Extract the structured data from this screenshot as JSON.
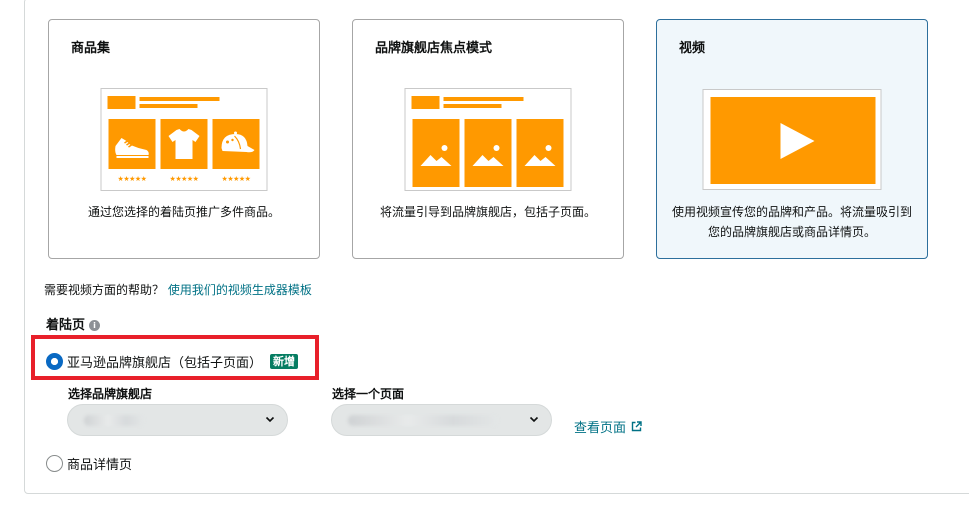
{
  "cards": [
    {
      "title": "商品集",
      "description": "通过您选择的着陆页推广多件商品。",
      "selected": false,
      "stars": [
        "★★★★★",
        "★★★★★",
        "★★★★★"
      ]
    },
    {
      "title": "品牌旗舰店焦点模式",
      "description": "将流量引导到品牌旗舰店，包括子页面。",
      "selected": false
    },
    {
      "title": "视频",
      "description": "使用视频宣传您的品牌和产品。将流量吸引到您的品牌旗舰店或商品详情页。",
      "selected": true
    }
  ],
  "help": {
    "question": "需要视频方面的帮助？",
    "link_text": "使用我们的视频生成器模板"
  },
  "landing_page": {
    "label": "着陆页",
    "info_icon": "i",
    "options": [
      {
        "label": "亚马逊品牌旗舰店（包括子页面）",
        "badge": "新增",
        "selected": true
      },
      {
        "label": "商品详情页",
        "selected": false
      }
    ]
  },
  "store_select": {
    "label": "选择品牌旗舰店"
  },
  "page_select": {
    "label": "选择一个页面"
  },
  "view_page": {
    "label": "查看页面"
  },
  "colors": {
    "accent": "#FF9900",
    "selected_bg": "#F0F7FB",
    "link": "#007185",
    "radio": "#0969C3",
    "badge": "#067D62",
    "highlight": "#E8202A"
  },
  "icons": {
    "shoe": "shoe-icon",
    "shirt": "tshirt-icon",
    "cap": "cap-icon",
    "image": "image-placeholder-icon",
    "play": "play-icon",
    "chevron": "chevron-down-icon",
    "external": "external-link-icon"
  }
}
